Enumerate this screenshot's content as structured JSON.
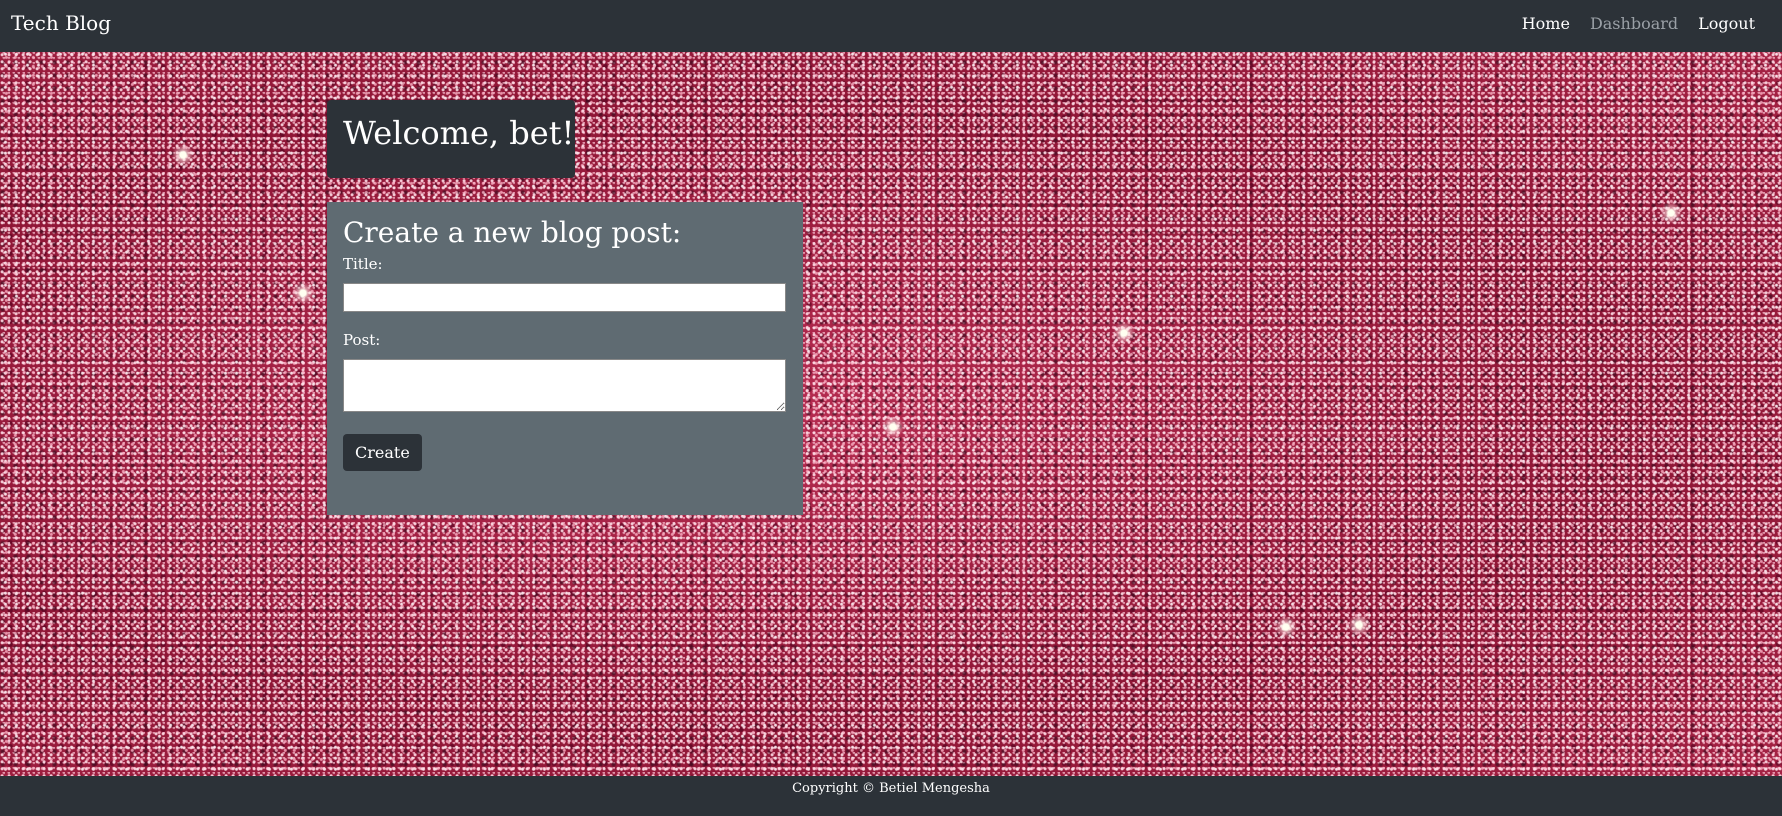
{
  "navbar": {
    "brand": "Tech Blog",
    "links": [
      {
        "label": "Home"
      },
      {
        "label": "Dashboard"
      },
      {
        "label": "Logout"
      }
    ]
  },
  "welcome": {
    "heading": "Welcome, bet!"
  },
  "form": {
    "heading": "Create a new blog post:",
    "title_label": "Title:",
    "title_value": "",
    "post_label": "Post:",
    "post_value": "",
    "submit_label": "Create"
  },
  "footer": {
    "copyright": "Copyright © Betiel Mengesha"
  },
  "colors": {
    "navbar_bg": "#2c3238",
    "form_bg": "#5f6b72",
    "background_accent": "#a01f3f",
    "muted_link": "#9aa0a6"
  }
}
